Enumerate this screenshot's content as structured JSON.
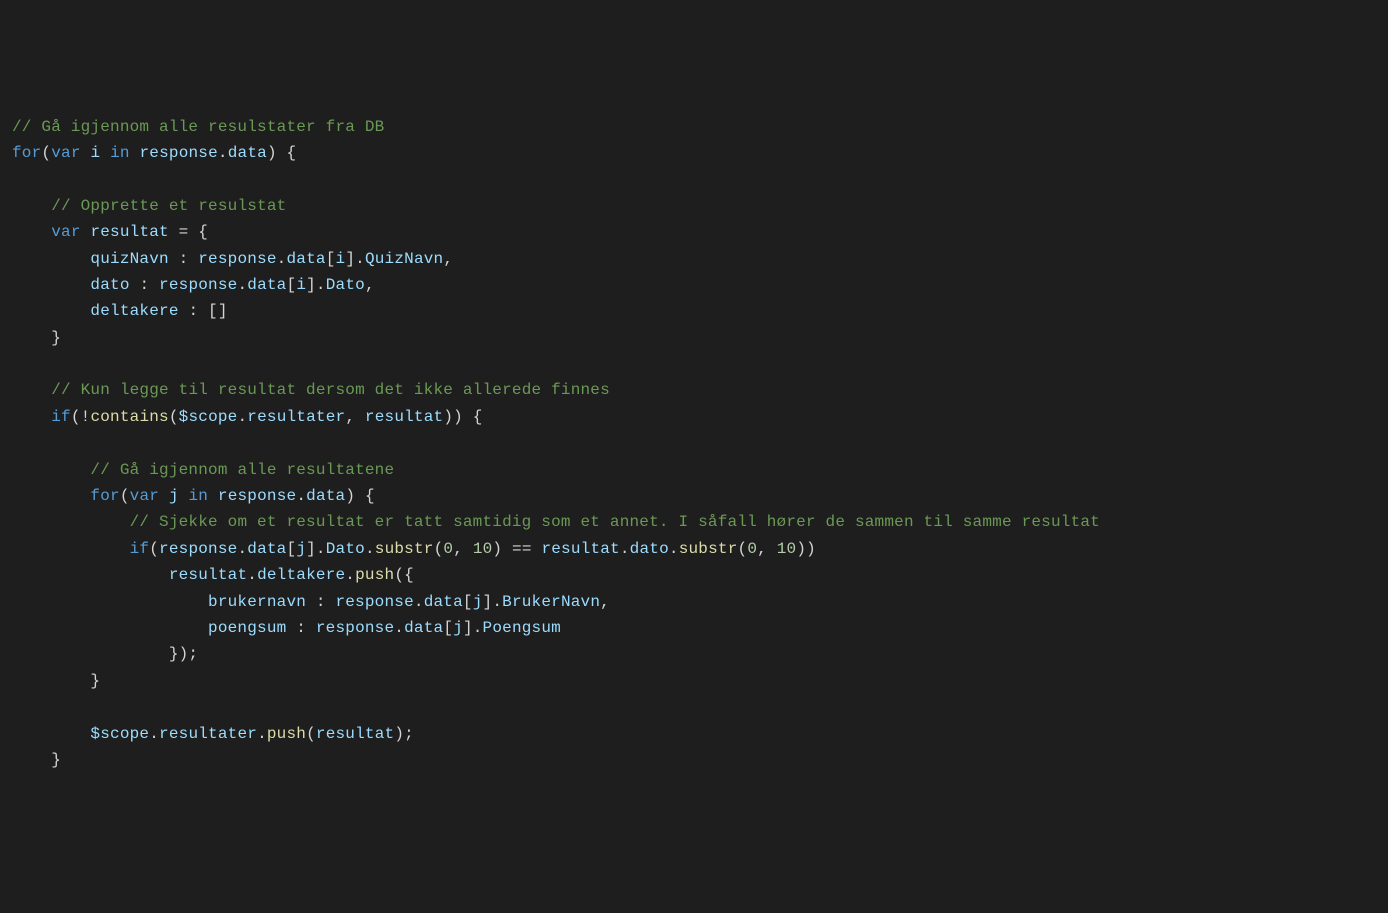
{
  "code": {
    "c1": "// Gå igjennom alle resulstater fra DB",
    "kw_for1": "for",
    "p_forOpen1": "(",
    "kw_var1": "var",
    "sp1": " ",
    "v_i": "i",
    "sp2": " ",
    "kw_in1": "in",
    "sp3": " ",
    "v_response1": "response",
    "p_dot1": ".",
    "v_data1": "data",
    "p_forClose1": ") {",
    "c2": "// Opprette et resulstat",
    "kw_var2": "var",
    "sp4": " ",
    "v_resultat": "resultat",
    "p_eq_open": " = {",
    "v_quizNavn": "quizNavn",
    "p_colon1": " : ",
    "v_response2": "response",
    "p_dot2": ".",
    "v_data2": "data",
    "p_lb1": "[",
    "v_i2": "i",
    "p_rb1": "].",
    "v_QuizNavn": "QuizNavn",
    "p_comma1": ",",
    "v_dato": "dato",
    "p_colon2": " : ",
    "v_response3": "response",
    "p_dot3": ".",
    "v_data3": "data",
    "p_lb2": "[",
    "v_i3": "i",
    "p_rb2": "].",
    "v_Dato1": "Dato",
    "p_comma2": ",",
    "v_deltakere": "deltakere",
    "p_colon3": " : []",
    "p_closeObj1": "}",
    "c3": "// Kun legge til resultat dersom det ikke allerede finnes",
    "kw_if1": "if",
    "p_ifOpen1": "(!",
    "f_contains": "contains",
    "p_cOpen": "(",
    "v_scope1": "$scope",
    "p_dot4": ".",
    "v_resultater1": "resultater",
    "p_comma3": ", ",
    "v_resultat2": "resultat",
    "p_ifClose1": ")) {",
    "c4": "// Gå igjennom alle resultatene",
    "kw_for2": "for",
    "p_forOpen2": "(",
    "kw_var3": "var",
    "sp5": " ",
    "v_j": "j",
    "sp6": " ",
    "kw_in2": "in",
    "sp7": " ",
    "v_response4": "response",
    "p_dot5": ".",
    "v_data4": "data",
    "p_forClose2": ") {",
    "c5": "// Sjekke om et resultat er tatt samtidig som et annet. I såfall hører de sammen til samme resultat",
    "kw_if2": "if",
    "p_ifOpen2": "(",
    "v_response5": "response",
    "p_dot6": ".",
    "v_data5": "data",
    "p_lb3": "[",
    "v_j2": "j",
    "p_rb3": "].",
    "v_Dato2": "Dato",
    "p_dot7": ".",
    "f_substr1": "substr",
    "p_sOpen1": "(",
    "n_0a": "0",
    "p_comma4": ", ",
    "n_10a": "10",
    "p_sClose1": ") == ",
    "v_resultat3": "resultat",
    "p_dot8": ".",
    "v_dato2": "dato",
    "p_dot9": ".",
    "f_substr2": "substr",
    "p_sOpen2": "(",
    "n_0b": "0",
    "p_comma5": ", ",
    "n_10b": "10",
    "p_sClose2": "))",
    "v_resultat4": "resultat",
    "p_dot10": ".",
    "v_deltakere2": "deltakere",
    "p_dot11": ".",
    "f_push1": "push",
    "p_pushOpen": "({",
    "v_brukernavn": "brukernavn",
    "p_colon4": " : ",
    "v_response6": "response",
    "p_dot12": ".",
    "v_data6": "data",
    "p_lb4": "[",
    "v_j3": "j",
    "p_rb4": "].",
    "v_BrukerNavn": "BrukerNavn",
    "p_comma6": ",",
    "v_poengsum": "poengsum",
    "p_colon5": " : ",
    "v_response7": "response",
    "p_dot13": ".",
    "v_data7": "data",
    "p_lb5": "[",
    "v_j4": "j",
    "p_rb5": "].",
    "v_Poengsum": "Poengsum",
    "p_pushClose": "});",
    "p_closeFor2": "}",
    "v_scope2": "$scope",
    "p_dot14": ".",
    "v_resultater2": "resultater",
    "p_dot15": ".",
    "f_push2": "push",
    "p_pushOpen2": "(",
    "v_resultat5": "resultat",
    "p_pushClose2": ");",
    "p_closeIf": "}"
  }
}
